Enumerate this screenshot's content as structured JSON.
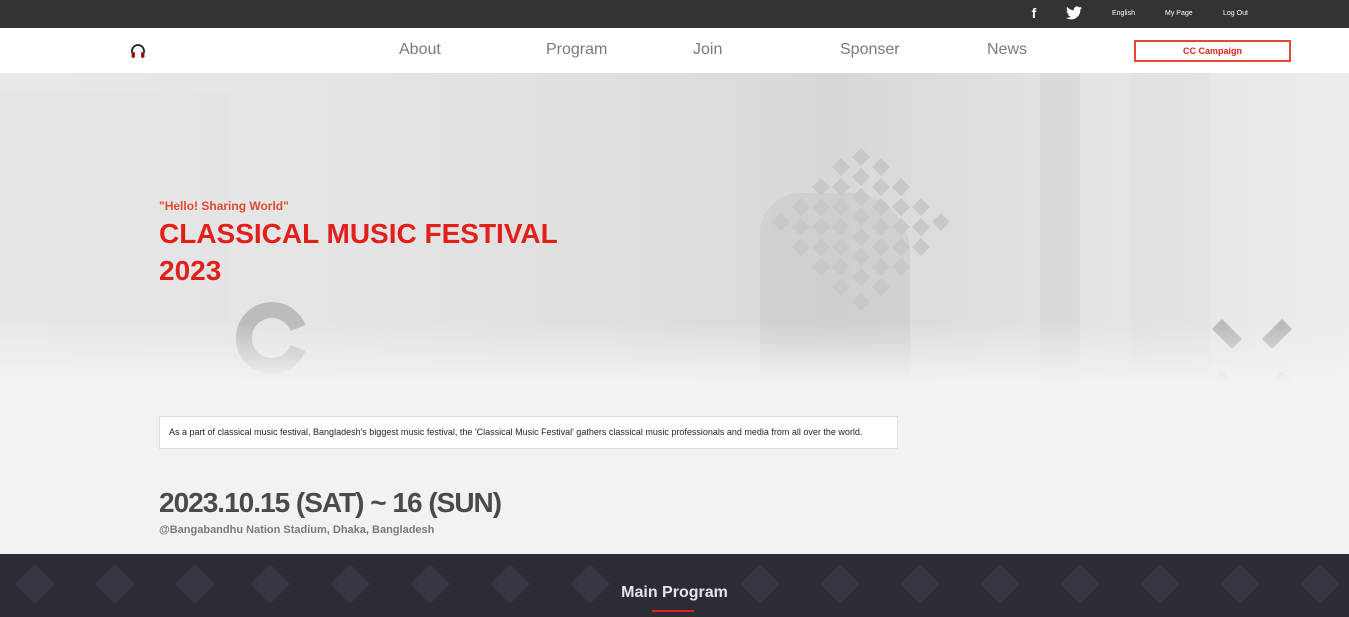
{
  "topbar": {
    "facebook_icon": "facebook-icon",
    "twitter_icon": "twitter-icon",
    "links": [
      "English",
      "My Page",
      "Log Out"
    ]
  },
  "nav": {
    "logo_icon": "headphones-icon",
    "items": [
      "About",
      "Program",
      "Join",
      "Sponser",
      "News"
    ],
    "cta_label": "CC Campaign"
  },
  "hero": {
    "tagline": "\"Hello! Sharing World\"",
    "title_line1": "CLASSICAL MUSIC FESTIVAL",
    "title_line2": "2023",
    "description": "As a part of classical music festival, Bangladesh's biggest music festival, the 'Classical Music Festival' gathers classical music professionals and media from all over the world.",
    "date": "2023.10.15 (SAT) ~ 16 (SUN)",
    "venue": "@Bangabandhu Nation Stadium, Dhaka, Bangladesh"
  },
  "main_program": {
    "title": "Main Program"
  },
  "colors": {
    "accent_red": "#e2201b",
    "accent_orange": "#e24a33",
    "topbar_bg": "#333333",
    "section_dark": "#2b2d35"
  }
}
